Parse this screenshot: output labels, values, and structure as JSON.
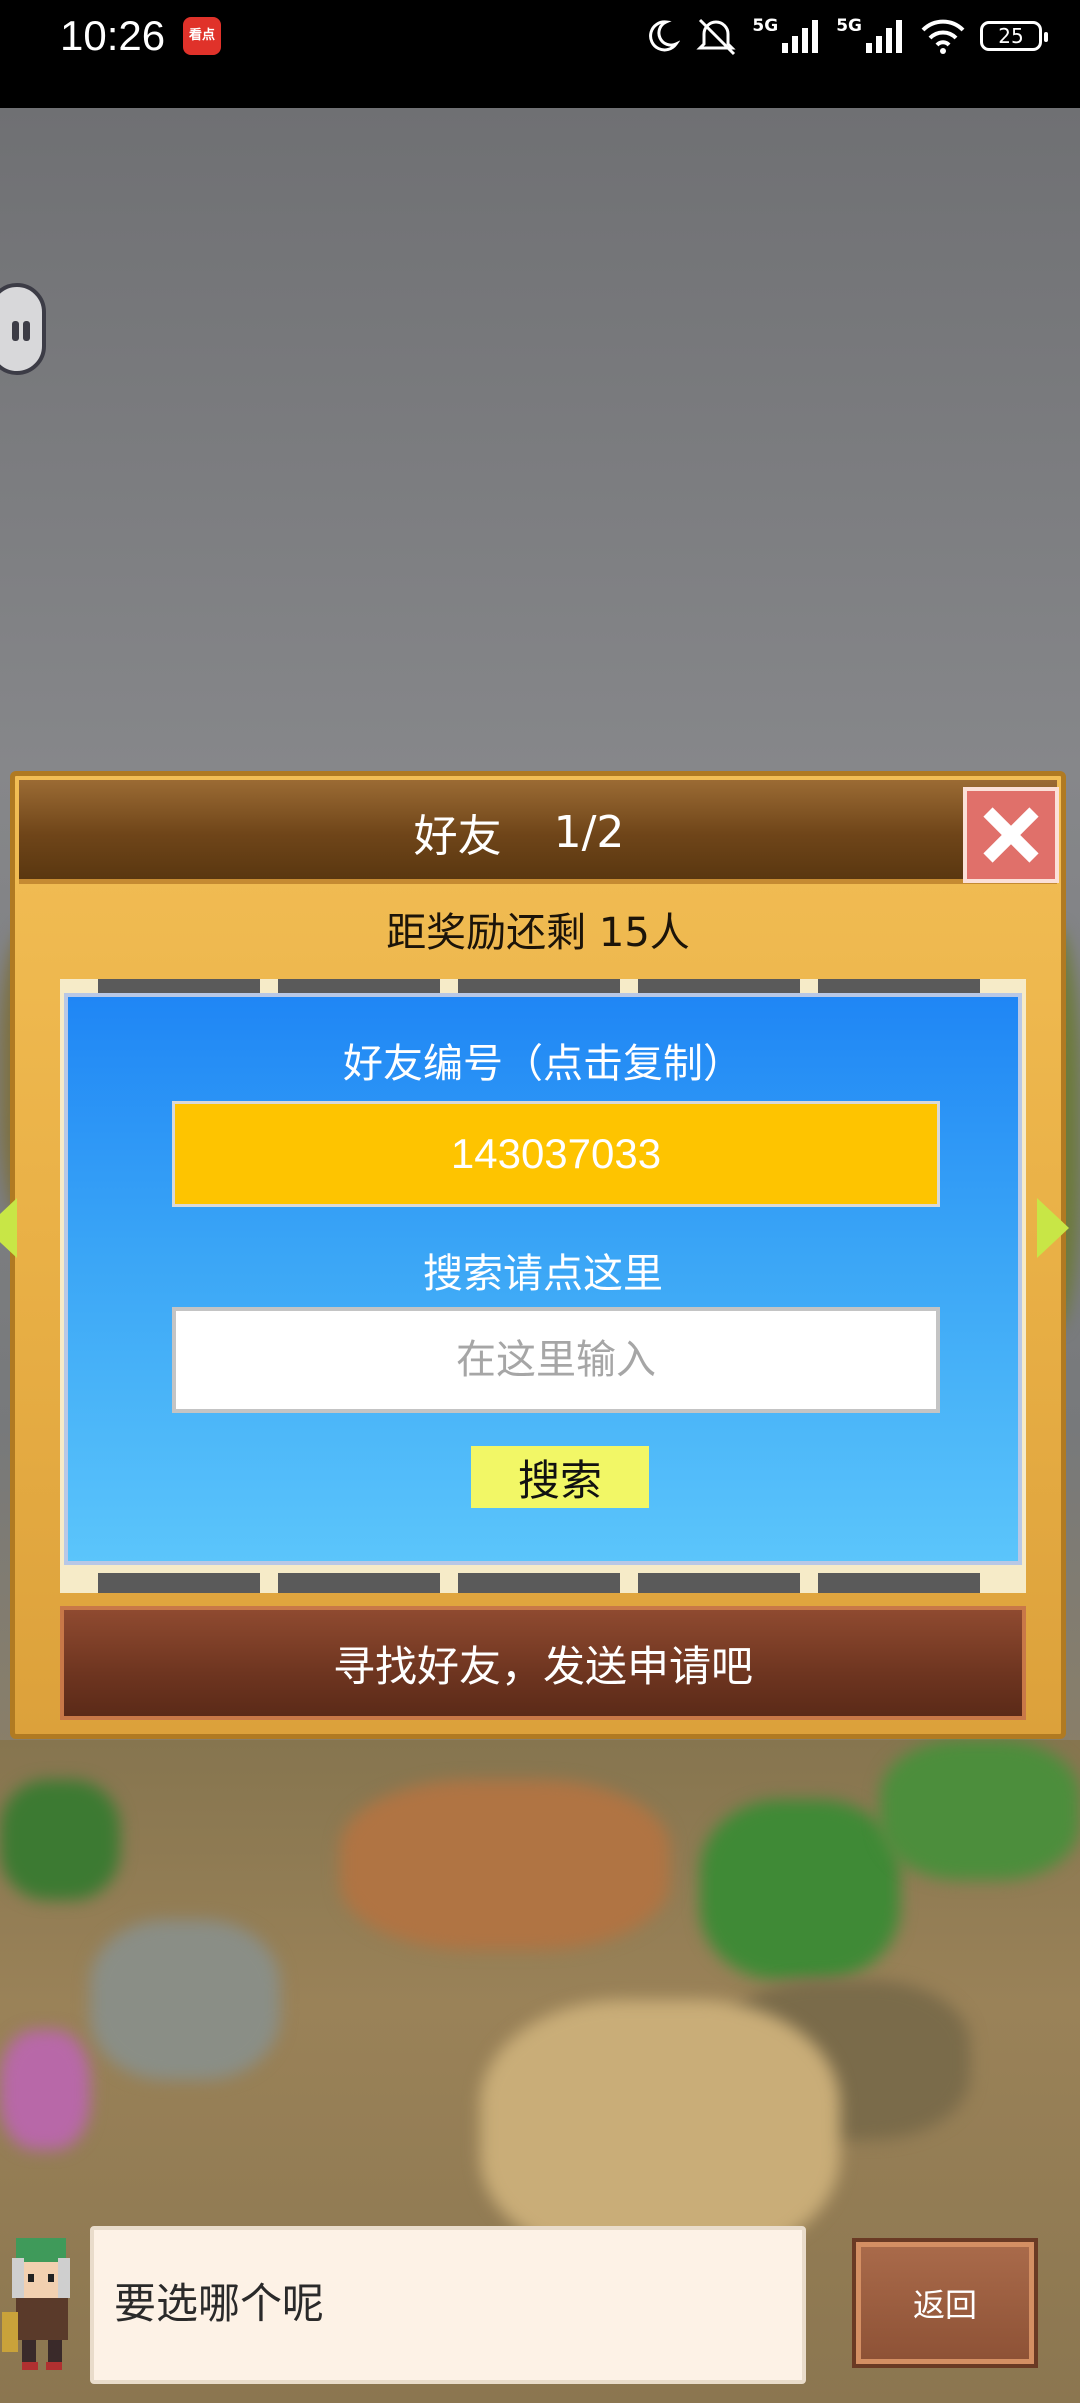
{
  "status_bar": {
    "time": "10:26",
    "app_icon": "看点",
    "signal_1_label": "5G",
    "signal_2_label": "5G",
    "battery": "25",
    "icons": [
      "moon-icon",
      "mute-icon",
      "signal-icon",
      "signal-icon",
      "wifi-icon",
      "battery-icon"
    ]
  },
  "dialog": {
    "title": "好友",
    "page": "1/2",
    "reward_text": "距奖励还剩 15人",
    "friend_id_label": "好友编号（点击复制）",
    "friend_id": "143037033",
    "search_label": "搜索请点这里",
    "search_placeholder": "在这里输入",
    "search_button": "搜索",
    "find_friends_button": "寻找好友，发送申请吧"
  },
  "bottom": {
    "speech": "要选哪个呢",
    "back_button": "返回"
  },
  "colors": {
    "dialog_bg": "#e9b046",
    "header_bg": "#6f4519",
    "panel_blue": "#1f86f5",
    "friend_id_bg": "#fec400",
    "search_button_bg": "#f2f766",
    "close_button_bg": "#e0706a",
    "arrow": "#c8e646"
  }
}
